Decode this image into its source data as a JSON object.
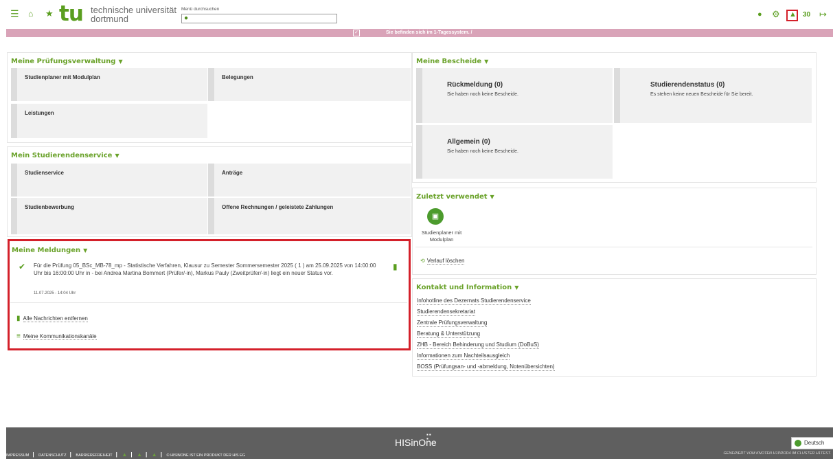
{
  "header": {
    "menu_icon": "hamburger-icon",
    "home_icon": "home-icon",
    "favorite_icon": "star-icon",
    "logo_mark": "tu",
    "logo_line1": "technische universität",
    "logo_line2": "dortmund",
    "search_label": "Menü durchsuchen",
    "search_placeholder": "",
    "notification_count": "30",
    "icons": [
      "user-icon",
      "gear-icon",
      "bell-icon",
      "logout-icon"
    ],
    "accent": "#5a9e1f"
  },
  "system_bar": {
    "message": "Sie befinden sich im 1-Tagessystem. /",
    "color": "#d9a3b8"
  },
  "pruefung": {
    "title": "Meine Prüfungsverwaltung",
    "tiles": [
      "Studienplaner mit Modulplan",
      "Belegungen",
      "Leistungen"
    ]
  },
  "service": {
    "title": "Mein Studierendenservice",
    "tiles": [
      "Studienservice",
      "Anträge",
      "Studienbewerbung",
      "Offene Rechnungen / geleistete Zahlungen"
    ]
  },
  "meldungen": {
    "title": "Meine Meldungen",
    "message": "Für die Prüfung 05_BSc_MB-78_mp - Statistische Verfahren, Klausur zu Semester Sommersemester 2025 ( 1 ) am 25.09.2025 von 14:00:00 Uhr bis 16:00:00 Uhr in - bei Andrea Martina Bommert (Prüfer/-in), Markus Pauly (Zweitprüfer/-in) liegt ein neuer Status vor.",
    "date": "11.07.2025 - 14:04 Uhr",
    "remove_all": "Alle Nachrichten entfernen",
    "channels": "Meine Kommunikationskanäle",
    "highlight_color": "#d4202a"
  },
  "bescheide": {
    "title": "Meine Bescheide",
    "tiles": [
      {
        "title": "Rückmeldung (0)",
        "sub": "Sie haben noch keine Bescheide."
      },
      {
        "title": "Studierendenstatus (0)",
        "sub": "Es stehen keine neuen Bescheide für Sie bereit."
      },
      {
        "title": "Allgemein (0)",
        "sub": "Sie haben noch keine Bescheide."
      }
    ]
  },
  "recent": {
    "title": "Zuletzt verwendet",
    "item_label": "Studienplaner mit Modulplan",
    "clear": "Verlauf löschen"
  },
  "kontakt": {
    "title": "Kontakt und Information",
    "links": [
      "Infohotline des Dezernats Studierendenservice",
      "Studierendensekretariat",
      "Zentrale Prüfungsverwaltung",
      "Beratung & Unterstützung",
      "ZHB - Bereich Behinderung und Studium (DoBuS)",
      "Informationen zum Nachteilsausgleich",
      "BOSS (Prüfungsan- und -abmeldung, Notenübersichten)"
    ]
  },
  "footer": {
    "brand": "HISinOne",
    "nav": [
      "IMPRESSUM",
      "DATENSCHUTZ",
      "BARRIEREFREIHEIT"
    ],
    "product": "© HISINONE IST EIN PRODUKT DER HIS EG",
    "generated": "GENERIERT VOM KNOTEN H1PROD4 IM CLUSTER H1TEST.",
    "language": "Deutsch"
  }
}
